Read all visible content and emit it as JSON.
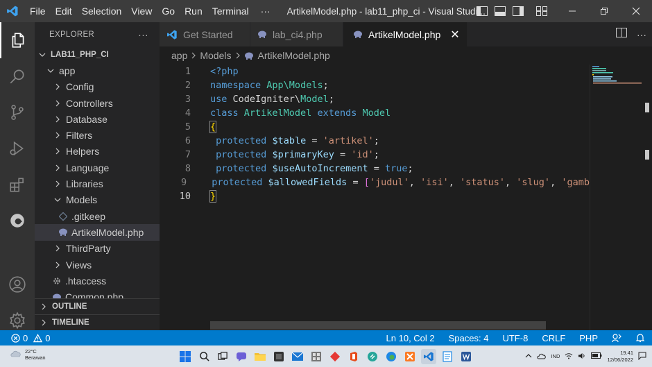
{
  "titlebar": {
    "menu": [
      "File",
      "Edit",
      "Selection",
      "View",
      "Go",
      "Run",
      "Terminal",
      "···"
    ],
    "title": "ArtikelModel.php - lab11_php_ci - Visual Studi..."
  },
  "activity_icons": [
    "explorer-icon",
    "search-icon",
    "source-control-icon",
    "run-debug-icon",
    "extensions-icon",
    "edge-icon",
    "account-icon",
    "settings-gear-icon"
  ],
  "sidebar": {
    "title": "EXPLORER",
    "more": "···",
    "root": "LAB11_PHP_CI",
    "tree": [
      {
        "label": "app",
        "expanded": true,
        "depth": 1
      },
      {
        "label": "Config",
        "depth": 2
      },
      {
        "label": "Controllers",
        "depth": 2
      },
      {
        "label": "Database",
        "depth": 2
      },
      {
        "label": "Filters",
        "depth": 2
      },
      {
        "label": "Helpers",
        "depth": 2
      },
      {
        "label": "Language",
        "depth": 2
      },
      {
        "label": "Libraries",
        "depth": 2
      },
      {
        "label": "Models",
        "expanded": true,
        "depth": 2
      },
      {
        "label": ".gitkeep",
        "file": "gitkeep",
        "depth": 3
      },
      {
        "label": "ArtikelModel.php",
        "file": "php",
        "depth": 3,
        "selected": true
      },
      {
        "label": "ThirdParty",
        "depth": 2
      },
      {
        "label": "Views",
        "depth": 2
      },
      {
        "label": ".htaccess",
        "file": "gear",
        "depth": 2
      },
      {
        "label": "Common.php",
        "file": "php",
        "depth": 2
      }
    ],
    "outline": "OUTLINE",
    "timeline": "TIMELINE"
  },
  "tabs": [
    {
      "label": "Get Started",
      "icon": "vscode-icon"
    },
    {
      "label": "lab_ci4.php",
      "icon": "php-icon"
    },
    {
      "label": "ArtikelModel.php",
      "icon": "php-icon",
      "active": true,
      "close": "✕"
    }
  ],
  "breadcrumb": [
    "app",
    "Models",
    "ArtikelModel.php"
  ],
  "editor": {
    "line_numbers": [
      "1",
      "2",
      "3",
      "4",
      "5",
      "6",
      "7",
      "8",
      "9",
      "10"
    ],
    "lines": [
      "<?php",
      "namespace App\\Models;",
      "use CodeIgniter\\Model;",
      "class ArtikelModel extends Model",
      "{",
      " protected $table = 'artikel';",
      " protected $primaryKey = 'id';",
      " protected $useAutoIncrement = true;",
      " protected $allowedFields = ['judul', 'isi', 'status', 'slug', 'gamb",
      "}"
    ],
    "current_line": 10
  },
  "statusbar": {
    "errors": "0",
    "warnings": "0",
    "position": "Ln 10, Col 2",
    "spaces": "Spaces: 4",
    "encoding": "UTF-8",
    "eol": "CRLF",
    "language": "PHP"
  },
  "taskbar": {
    "weather_temp": "22°C",
    "weather_desc": "Berawan",
    "lang": "IND",
    "time": "19.41",
    "date": "12/06/2022"
  },
  "colors": {
    "statusbar": "#007acc",
    "keyword": "#569cd6",
    "class": "#4ec9b0",
    "variable": "#9cdcfe",
    "string": "#ce9178"
  }
}
